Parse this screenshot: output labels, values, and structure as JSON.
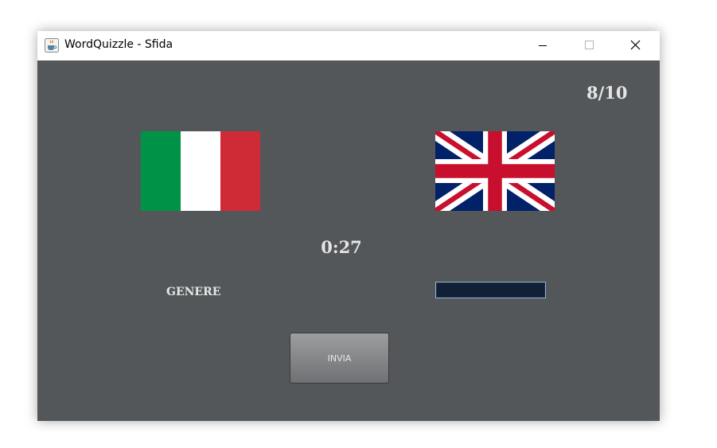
{
  "window": {
    "title": "WordQuizzle - Sfida",
    "app_icon": "java-coffee-cup-icon",
    "controls": [
      "minimize-icon",
      "maximize-icon",
      "close-icon"
    ]
  },
  "challenge": {
    "progress": "8/10",
    "timer": "0:27",
    "word": "GENERE",
    "answer_value": "",
    "send_label": "INVIA",
    "source_flag": "italy-flag-icon",
    "target_flag": "uk-flag-icon"
  },
  "colors": {
    "background": "#53575a",
    "text": "#e6e6e6",
    "input_background": "#122036",
    "italy_green": "#009246",
    "italy_white": "#ffffff",
    "italy_red": "#ce2b37",
    "uk_blue": "#012169",
    "uk_red": "#c8102e"
  }
}
